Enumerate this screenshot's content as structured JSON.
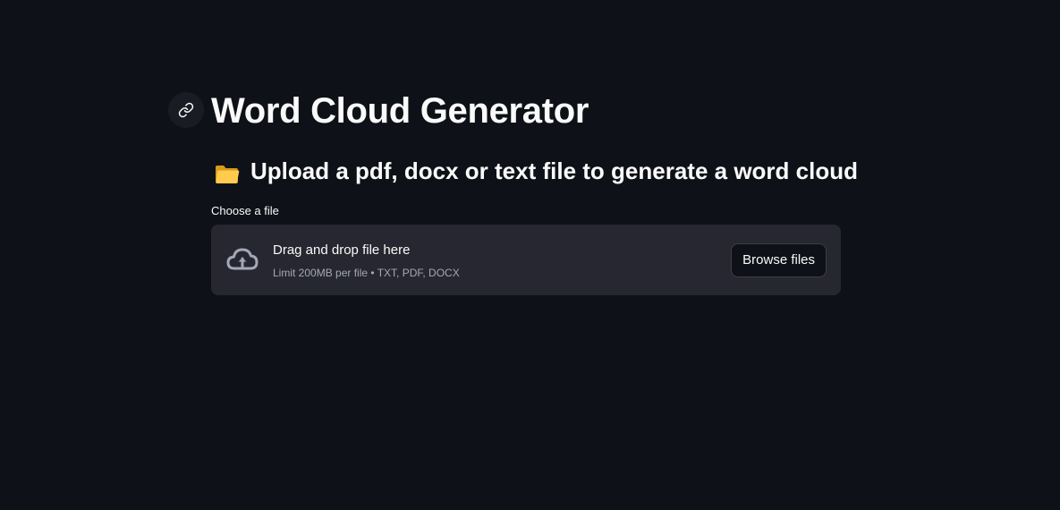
{
  "header": {
    "title": "Word Cloud Generator"
  },
  "subheader": {
    "icon": "folder-icon",
    "text": "Upload a pdf, docx or text file to generate a word cloud"
  },
  "uploader": {
    "label": "Choose a file",
    "drop_text": "Drag and drop file here",
    "limit_text": "Limit 200MB per file • TXT, PDF, DOCX",
    "browse_label": "Browse files",
    "icon": "cloud-upload-icon"
  },
  "colors": {
    "background": "#0e1117",
    "dropzone": "#262730",
    "text": "#fafafa",
    "muted_text": "#a3a8b8"
  }
}
